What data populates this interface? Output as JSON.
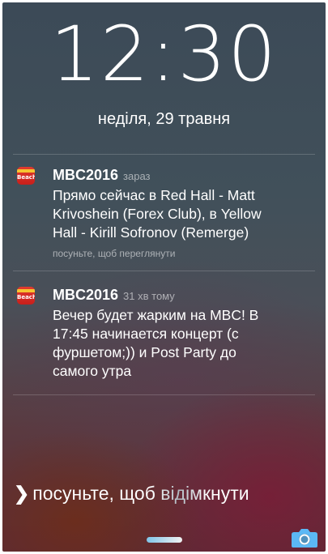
{
  "lock_screen": {
    "time": "12:30",
    "date": "неділя, 29 травня"
  },
  "notifications": [
    {
      "app": "MBC2016",
      "time": "зараз",
      "message_lines": [
        "Прямо сейчас в Red Hall - Matt",
        "Krivoshein (Forex Club), в Yellow",
        "Hall - Kirill Sofronov (Remerge)"
      ],
      "hint": "посуньте, щоб переглянути",
      "icon": "mbc-app-icon"
    },
    {
      "app": "MBC2016",
      "time": "31 хв тому",
      "message_lines": [
        "Вечер будет жарким на MBC! В",
        "17:45 начинается концерт (с",
        "фуршетом;)) и Post Party до",
        "самого утра"
      ],
      "icon": "mbc-app-icon"
    }
  ],
  "unlock": {
    "chevron": "❯",
    "label": "посуньте, щоб відімкнути"
  },
  "icons": {
    "camera": "camera-icon",
    "app": "mbc-app-icon"
  },
  "colors": {
    "handle_accent": "#7fc4e8",
    "camera": "#5bb8f5"
  }
}
